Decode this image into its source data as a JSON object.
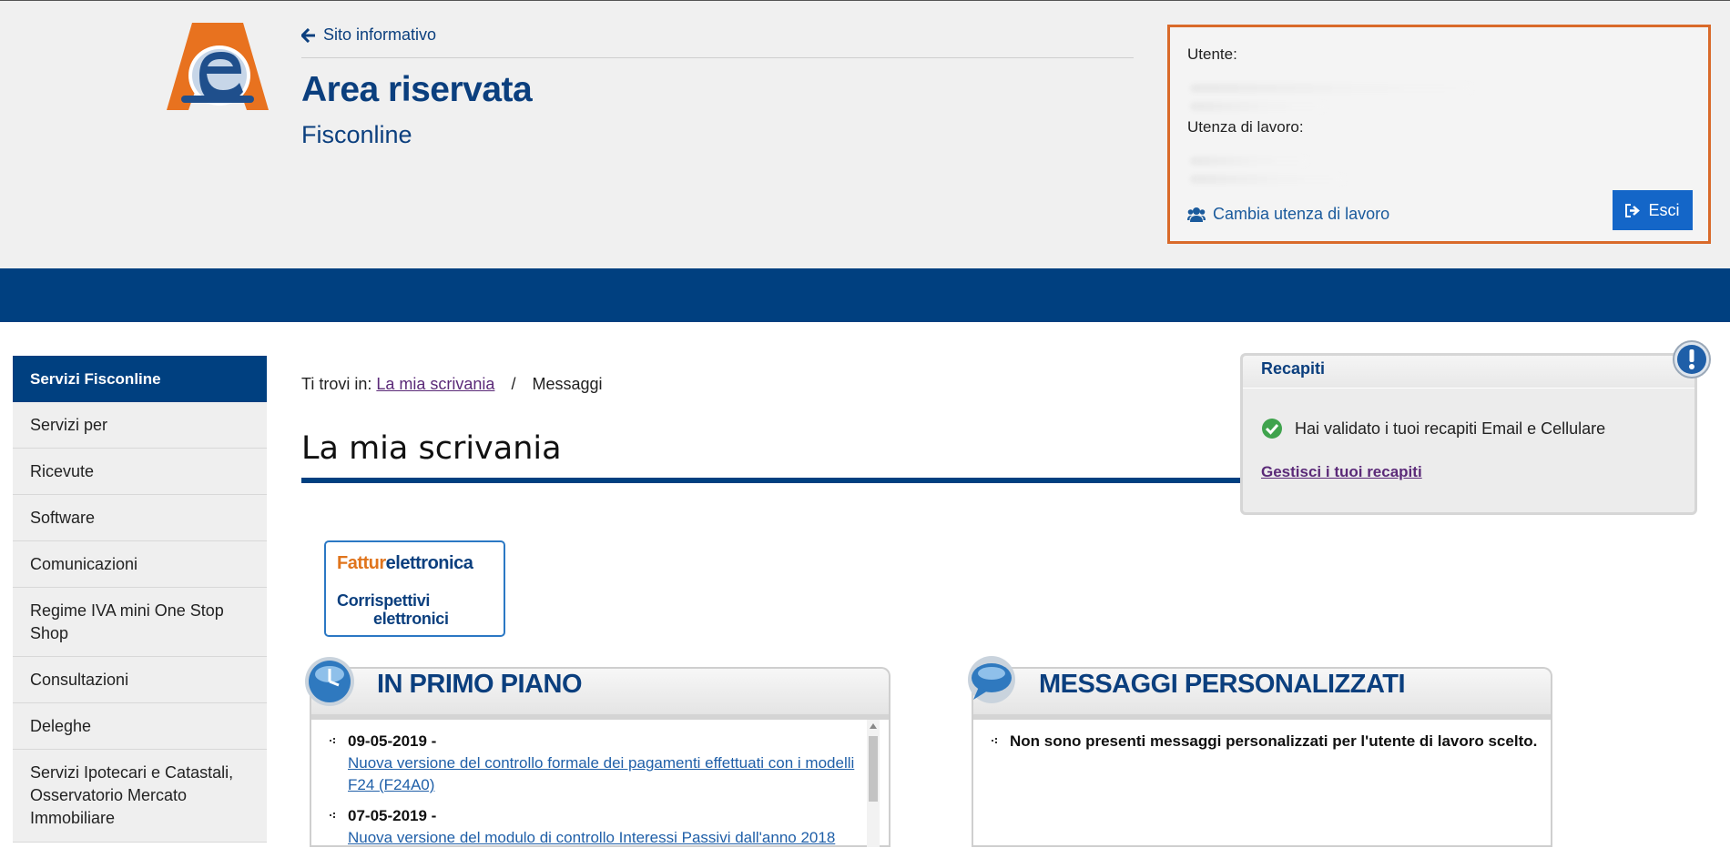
{
  "header": {
    "back_link": "Sito informativo",
    "title": "Area riservata",
    "subtitle": "Fisconline",
    "user_label": "Utente:",
    "work_label": "Utenza di lavoro:",
    "change_link": "Cambia utenza di lavoro",
    "logout_label": "Esci"
  },
  "sidebar": {
    "heading": "Servizi Fisconline",
    "items": [
      "Servizi per",
      "Ricevute",
      "Software",
      "Comunicazioni",
      "Regime IVA mini One Stop Shop",
      "Consultazioni",
      "Deleghe",
      "Servizi Ipotecari e Catastali, Osservatorio Mercato Immobiliare"
    ]
  },
  "breadcrumb": {
    "prefix": "Ti trovi in:",
    "link": "La mia scrivania",
    "separator": "/",
    "current": "Messaggi"
  },
  "page_title": "La mia scrivania",
  "banner": {
    "line1_a": "Fattur",
    "line1_b": "elettronica",
    "line2": "Corrispettivi",
    "line3": "elettronici"
  },
  "recapiti": {
    "title": "Recapiti",
    "message": "Hai validato i tuoi recapiti Email e Cellulare",
    "link": "Gestisci i tuoi recapiti"
  },
  "primo_piano": {
    "title": "IN PRIMO PIANO",
    "items": [
      {
        "date": "09-05-2019 -",
        "text": "Nuova versione del controllo formale dei pagamenti effettuati con i modelli F24 (F24A0)"
      },
      {
        "date": "07-05-2019 -",
        "text": "Nuova versione del modulo di controllo Interessi Passivi dall'anno 2018"
      }
    ]
  },
  "messaggi": {
    "title": "MESSAGGI PERSONALIZZATI",
    "items": [
      "Non sono presenti messaggi personalizzati per l'utente di lavoro scelto."
    ]
  },
  "colors": {
    "brand_blue": "#004080",
    "accent_orange": "#d96a2a",
    "button_blue": "#1466c8"
  }
}
